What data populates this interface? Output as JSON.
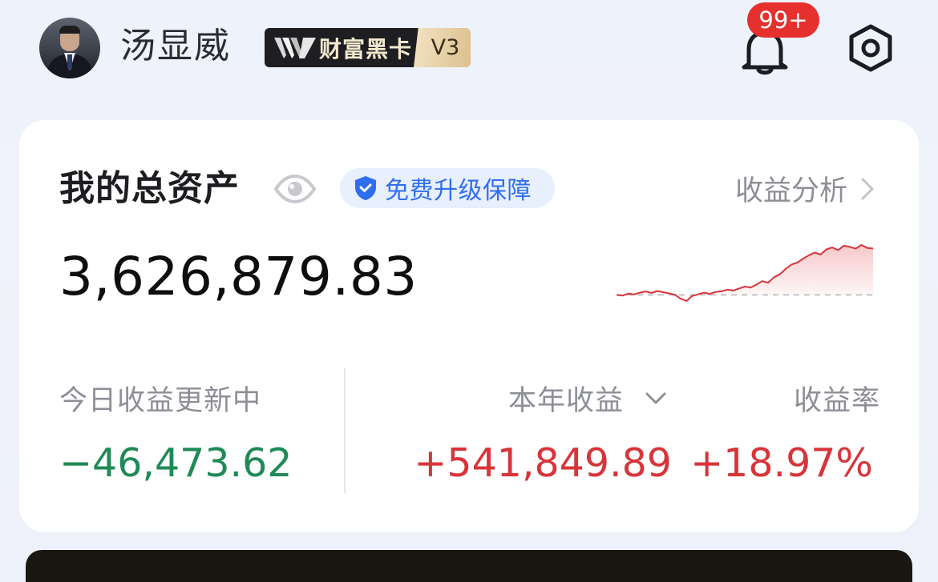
{
  "header": {
    "username": "汤显威",
    "vip_badge": {
      "label": "财富黑卡",
      "level": "V3"
    },
    "notification_count": "99+",
    "colors": {
      "badge_bg": "#1e1e22",
      "notif": "#e5302d"
    }
  },
  "assets": {
    "title": "我的总资产",
    "upgrade_label": "免费升级保障",
    "analysis_label": "收益分析",
    "total_value": "3,626,879.83",
    "today": {
      "label": "今日收益更新中",
      "value": "−46,473.62"
    },
    "year": {
      "label": "本年收益",
      "value": "+541,849.89"
    },
    "rate": {
      "label": "收益率",
      "value": "+18.97%"
    },
    "colors": {
      "gain": "#d8343a",
      "loss": "#1f8a56",
      "accent": "#2f6ef0"
    },
    "trend": [
      0,
      -0.3,
      0.5,
      0.2,
      0.9,
      1.4,
      0.8,
      1.6,
      1.1,
      0.6,
      0.1,
      -1.6,
      -2.5,
      -0.4,
      0.2,
      0.9,
      0.4,
      1.2,
      1.5,
      2.1,
      1.8,
      2.6,
      3.4,
      3.0,
      4.2,
      5.6,
      5.0,
      7.2,
      8.4,
      10.6,
      12.4,
      13.2,
      14.8,
      16.2,
      17.3,
      16.5,
      18.6,
      19.4,
      18.3,
      20.1,
      19.6,
      18.9,
      20.4,
      19.2,
      18.97
    ]
  },
  "icons": {
    "bell": "bell-icon",
    "settings": "settings-hexagon-icon",
    "eye": "eye-icon",
    "shield": "shield-check-icon",
    "chevron_right": "chevron-right-icon",
    "chevron_down": "chevron-down-icon"
  }
}
